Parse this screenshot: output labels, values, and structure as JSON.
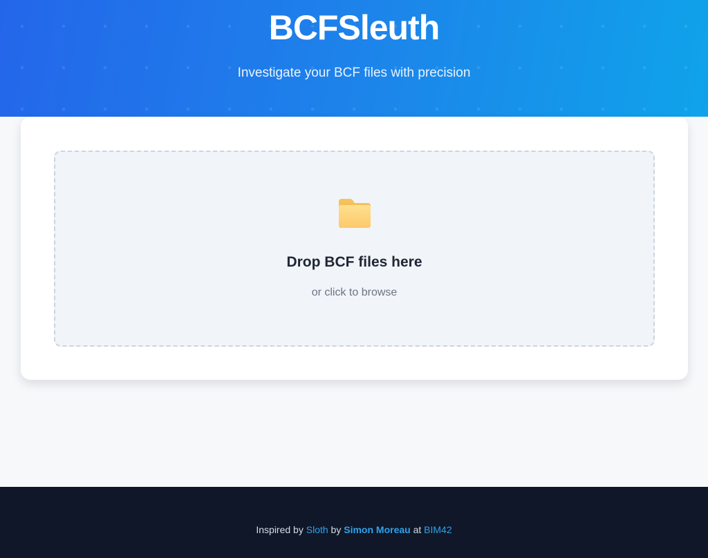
{
  "header": {
    "title": "BCFSleuth",
    "subtitle": "Investigate your BCF files with precision"
  },
  "dropzone": {
    "icon": "folder-icon",
    "title": "Drop BCF files here",
    "hint": "or click to browse"
  },
  "footer": {
    "prefix": "Inspired by",
    "project_link": "Sloth",
    "by_text": "by",
    "author_link": "Simon Moreau",
    "at_text": "at",
    "company_link": "BIM42"
  },
  "colors": {
    "header_gradient_start": "#2466ea",
    "header_gradient_end": "#0fa3ea",
    "footer_background": "#0f1729",
    "link": "#2fa3ea",
    "folder": "#fcd37a"
  }
}
